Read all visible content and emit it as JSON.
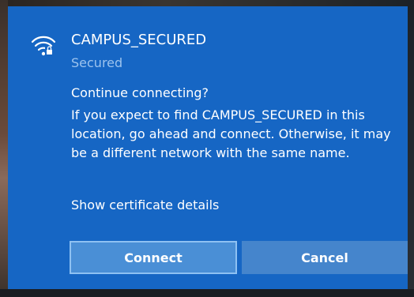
{
  "network": {
    "ssid": "CAMPUS_SECURED",
    "status": "Secured",
    "icon": "wifi-secured-icon"
  },
  "prompt": {
    "question": "Continue connecting?",
    "message": "If you expect to find CAMPUS_SECURED in this location, go ahead and connect. Otherwise, it may be a different network with the same name.",
    "cert_link": "Show certificate details"
  },
  "buttons": {
    "connect_label": "Connect",
    "cancel_label": "Cancel"
  },
  "colors": {
    "panel_bg": "#1666c4",
    "button_bg": "#4a8fd6",
    "button_border": "#8ec1f2",
    "secondary_text": "#9cc3ee"
  }
}
